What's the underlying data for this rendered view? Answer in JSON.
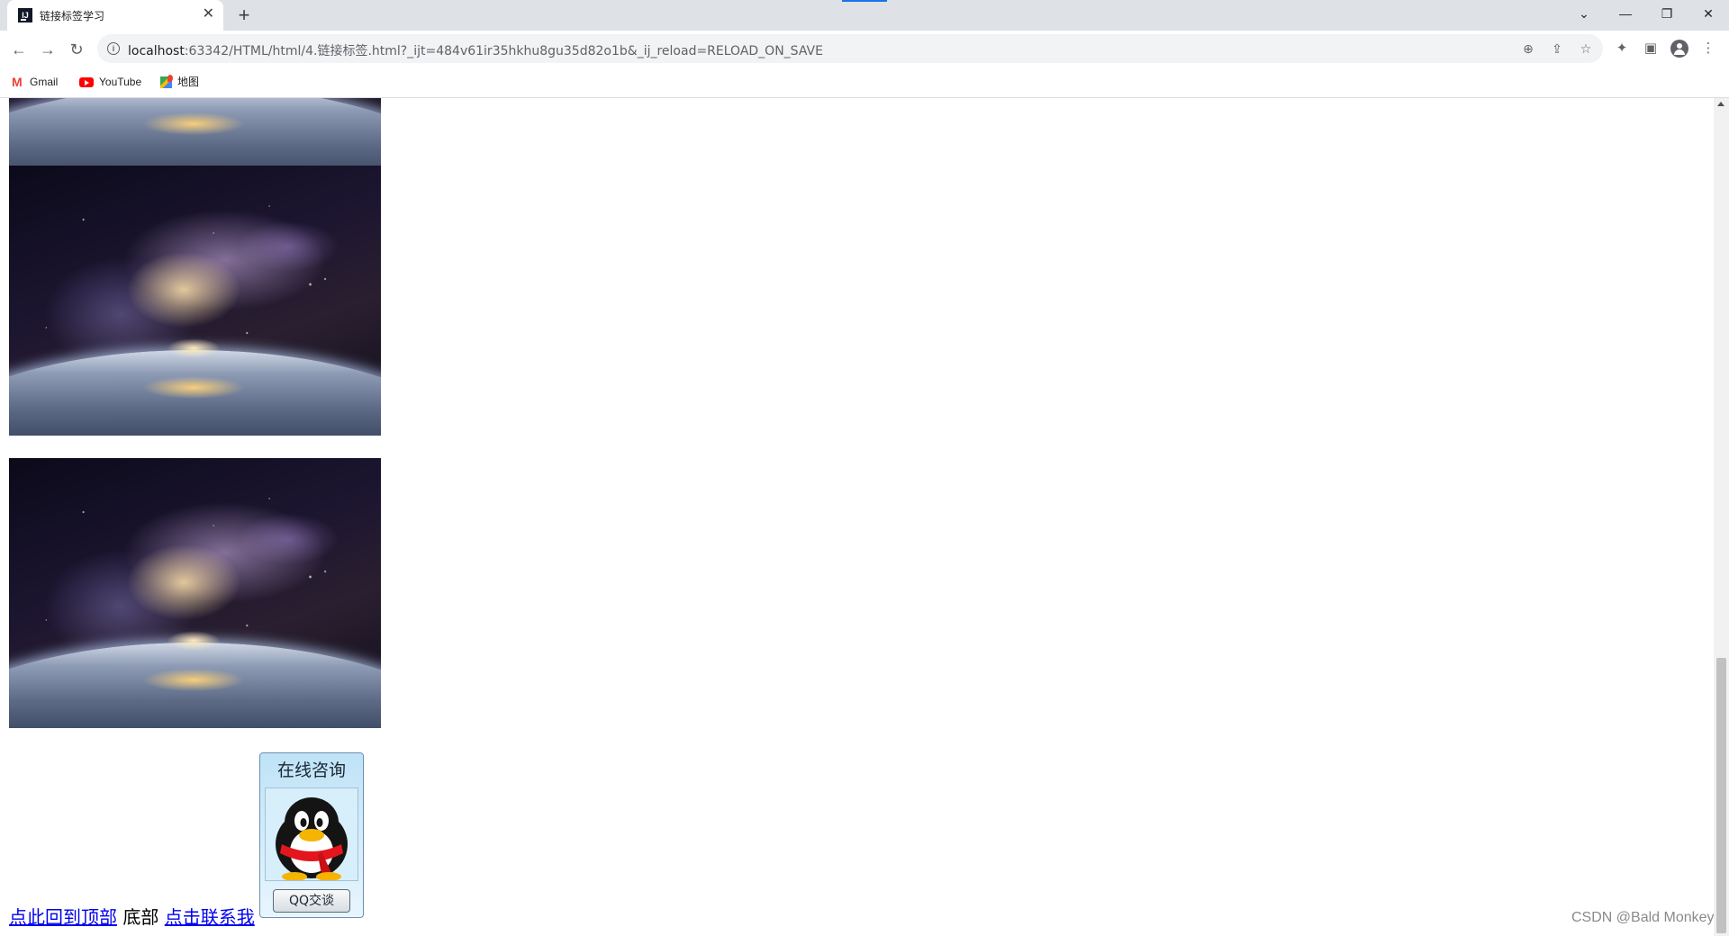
{
  "browser": {
    "tab_title": "链接标签学习",
    "tab_favicon_text": "IJ",
    "url_host": "localhost",
    "url_rest": ":63342/HTML/html/4.链接标签.html?_ijt=484v61ir35hkhu8gu35d82o1b&_ij_reload=RELOAD_ON_SAVE",
    "bookmarks": [
      {
        "label": "Gmail",
        "icon": "gmail-icon"
      },
      {
        "label": "YouTube",
        "icon": "youtube-icon"
      },
      {
        "label": "地图",
        "icon": "maps-icon"
      }
    ]
  },
  "page": {
    "qq_widget": {
      "title": "在线咨询",
      "button_label": "QQ交谈"
    },
    "footer": {
      "back_to_top_link": "点此回到顶部",
      "bottom_text": "底部",
      "contact_link": "点击联系我"
    },
    "watermark": "CSDN @Bald Monkey"
  },
  "colors": {
    "link": "#0000ee",
    "chrome_bg": "#dee1e6",
    "omnibox_bg": "#f1f3f4"
  }
}
